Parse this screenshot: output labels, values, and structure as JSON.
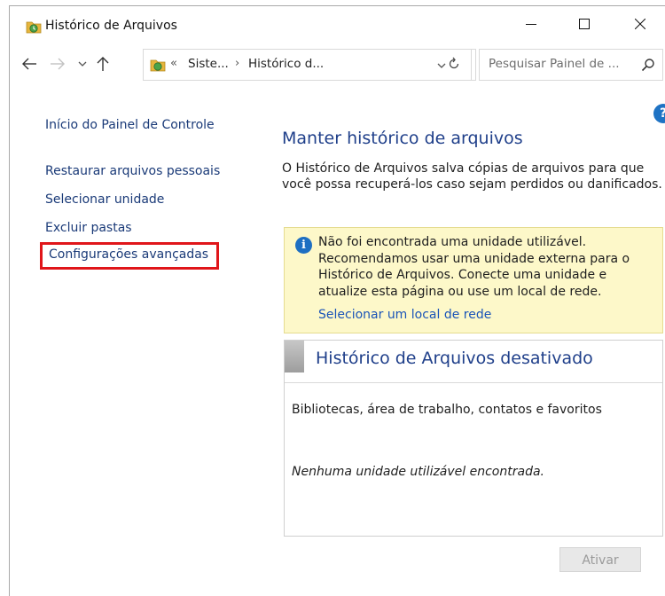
{
  "window": {
    "title": "Histórico de Arquivos",
    "app_icon": "file-history-icon",
    "controls": {
      "minimize": "minimize-icon",
      "maximize": "maximize-icon",
      "close": "close-icon"
    }
  },
  "address_bar": {
    "overflow": "«",
    "crumbs": [
      "Siste...",
      "Histórico d..."
    ],
    "separator": "›",
    "search_placeholder": "Pesquisar Painel de ..."
  },
  "left_nav": {
    "home": "Início do Painel de Controle",
    "items": [
      "Restaurar arquivos pessoais",
      "Selecionar unidade",
      "Excluir pastas",
      "Configurações avançadas"
    ],
    "highlighted_item": "Configurações avançadas",
    "highlight_color": "#e0161a"
  },
  "main": {
    "title": "Manter histórico de arquivos",
    "description": "O Histórico de Arquivos salva cópias de arquivos para que você possa recuperá-los caso sejam perdidos ou danificados.",
    "info": {
      "icon": "info-icon",
      "text": "Não foi encontrada uma unidade utilizável. Recomendamos usar uma unidade externa para o Histórico de Arquivos. Conecte uma unidade e atualize esta página ou use um local de rede.",
      "link": "Selecionar um local de rede"
    },
    "status": {
      "title": "Histórico de Arquivos desativado",
      "libraries": "Bibliotecas, área de trabalho, contatos e favoritos",
      "drive_status": "Nenhuma unidade utilizável encontrada."
    },
    "activate_button": "Ativar"
  },
  "colors": {
    "link": "#1a3a78",
    "heading": "#1f3f8a",
    "info_bg": "#fdf8c9",
    "accent_blue": "#1e6fc2"
  }
}
